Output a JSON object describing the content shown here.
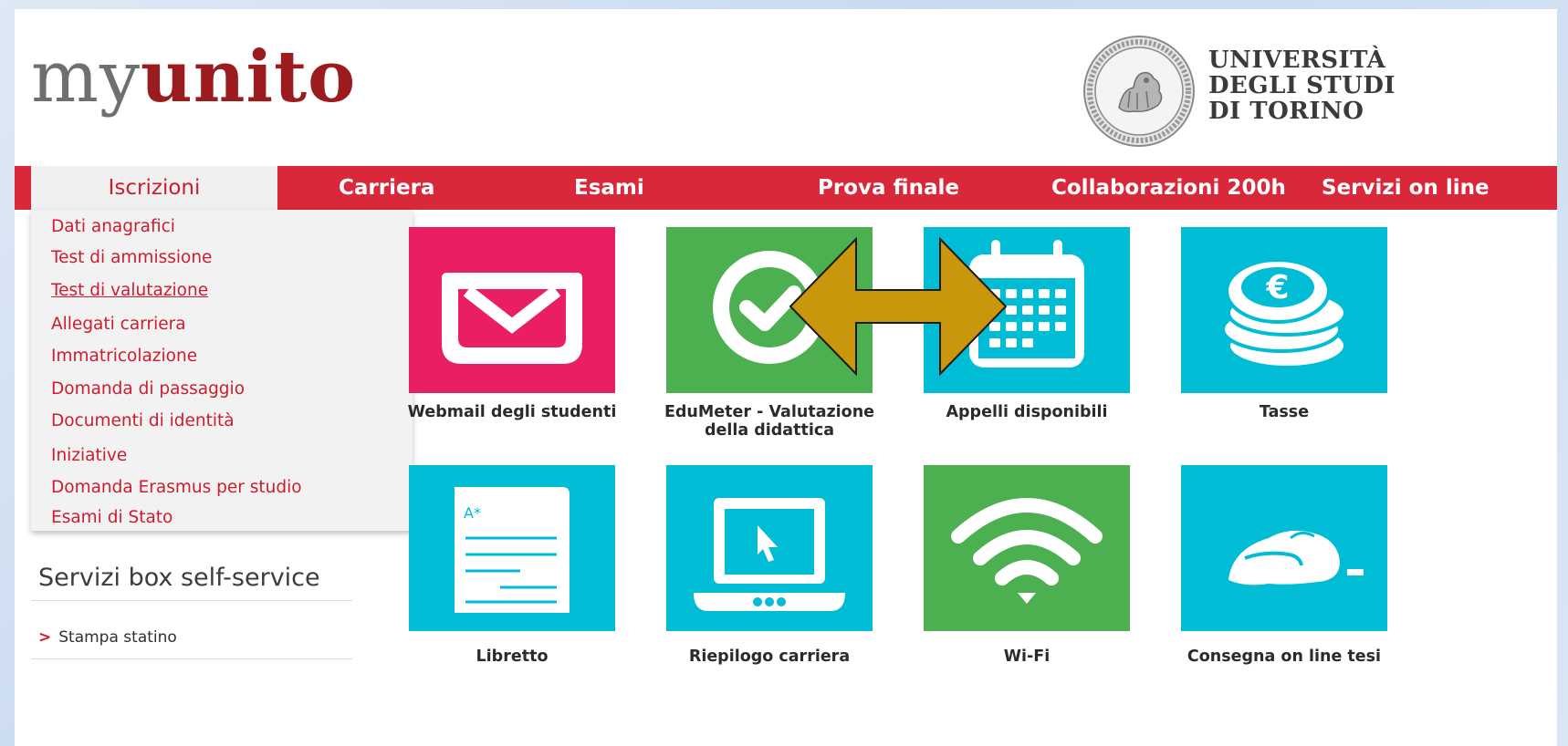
{
  "header": {
    "logo_my": "my",
    "logo_unito": "unito",
    "university_lines": [
      "UNIVERSITÀ",
      "DEGLI STUDI",
      "DI TORINO"
    ]
  },
  "nav": {
    "items": [
      {
        "label": "Iscrizioni",
        "active": true
      },
      {
        "label": "Carriera"
      },
      {
        "label": "Esami"
      },
      {
        "label": "Prova finale"
      },
      {
        "label": "Collaborazioni 200h"
      },
      {
        "label": "Servizi on line"
      }
    ]
  },
  "dropdown": {
    "items": [
      {
        "label": "Dati anagrafici"
      },
      {
        "label": "Test di ammissione"
      },
      {
        "label": "Test di valutazione",
        "hovered": true
      },
      {
        "label": "Allegati carriera"
      },
      {
        "label": "Immatricolazione"
      },
      {
        "label": "Domanda di passaggio"
      },
      {
        "label": "Documenti di identità"
      },
      {
        "label": "Iniziative"
      },
      {
        "label": "Domanda Erasmus per studio"
      },
      {
        "label": "Esami di Stato"
      }
    ]
  },
  "sidebar": {
    "title": "Servizi box self-service",
    "links": [
      {
        "label": "Stampa statino"
      }
    ]
  },
  "tiles": [
    {
      "label": "Webmail degli studenti",
      "icon": "envelope-icon",
      "color": "#e91e63"
    },
    {
      "label_lines": [
        "EduMeter - Valutazione",
        "della didattica"
      ],
      "icon": "check-circle-icon",
      "color": "#4caf50"
    },
    {
      "label": "Appelli disponibili",
      "icon": "calendar-icon",
      "color": "#00bcd4"
    },
    {
      "label": "Tasse",
      "icon": "coins-euro-icon",
      "color": "#00bcd4"
    },
    {
      "label": "Libretto",
      "icon": "document-icon",
      "color": "#00bcd4"
    },
    {
      "label": "Riepilogo carriera",
      "icon": "laptop-icon",
      "color": "#00bcd4"
    },
    {
      "label": "Wi-Fi",
      "icon": "wifi-icon",
      "color": "#4caf50"
    },
    {
      "label": "Consegna on line tesi",
      "icon": "mouse-hand-icon",
      "color": "#00bcd4"
    }
  ],
  "colors": {
    "brand_red": "#d9283a",
    "logo_red": "#9b1b1f",
    "annotation_arrow": "#c9960c"
  }
}
